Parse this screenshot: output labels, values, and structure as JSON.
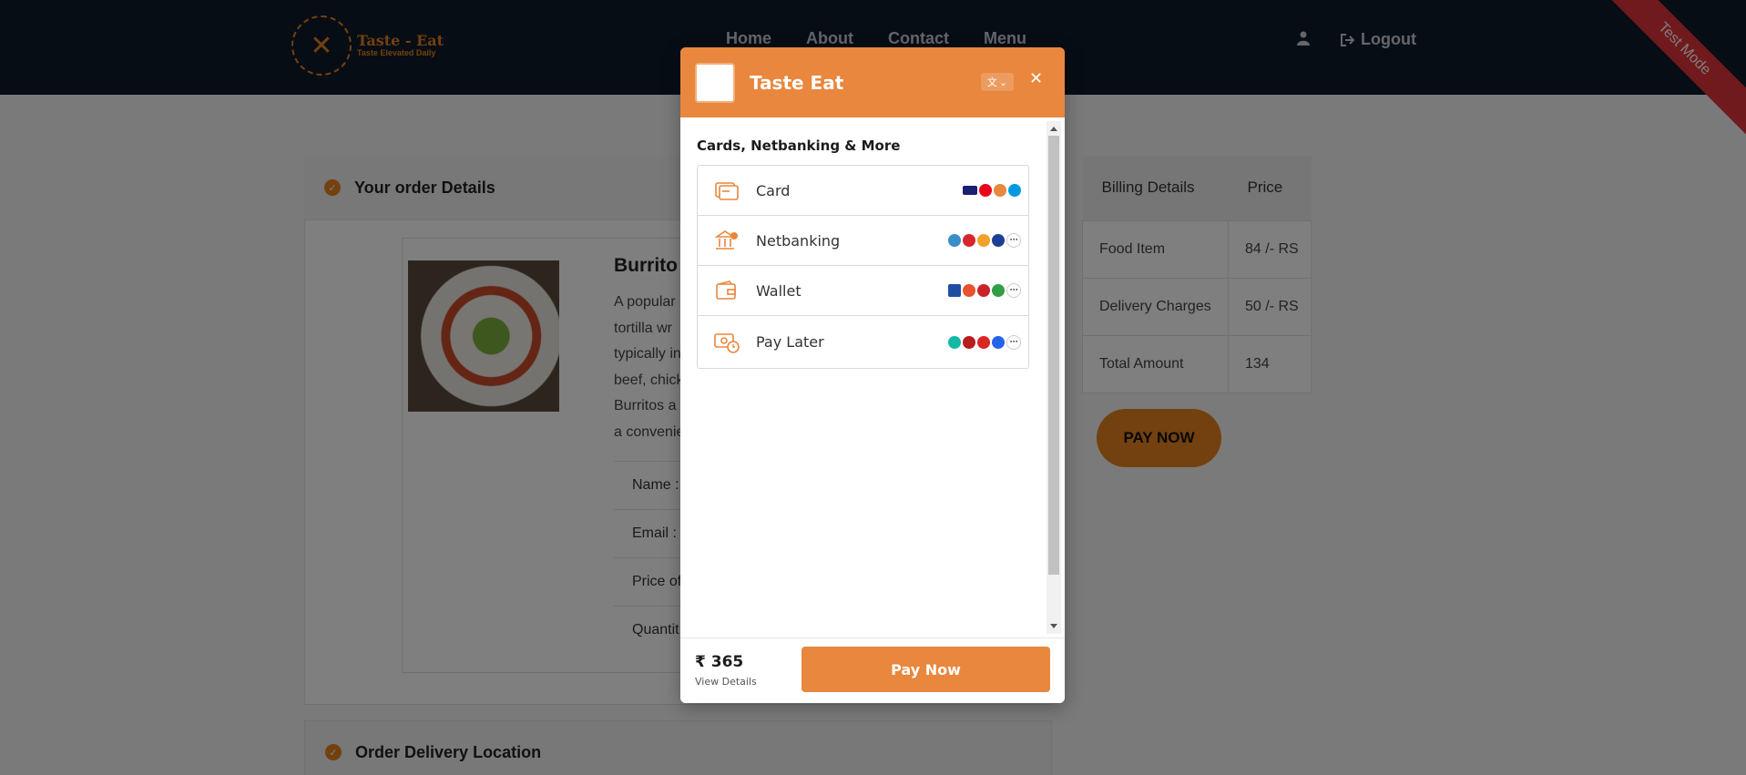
{
  "navbar": {
    "logo": {
      "name": "Taste - Eat",
      "tagline": "Taste Elevated Daily"
    },
    "links": [
      "Home",
      "About",
      "Contact",
      "Menu"
    ],
    "user_icon": "user-icon",
    "logout_icon": "logout-icon",
    "logout_label": "Logout"
  },
  "ribbon": "Test Mode",
  "order": {
    "title": "Your order Details",
    "item_name": "Burrito",
    "item_desc_lines": [
      "A popular",
      "tortilla wr",
      "typically in",
      "beef, chick",
      "Burritos a",
      "a convenie"
    ],
    "rows": [
      "Name :",
      "Email :",
      "Price of",
      "Quantit"
    ]
  },
  "delivery": {
    "title": "Order Delivery Location"
  },
  "billing": {
    "headers": [
      "Billing Details",
      "Price"
    ],
    "rows": [
      [
        "Food Item",
        "84 /- RS"
      ],
      [
        "Delivery Charges",
        "50 /- RS"
      ],
      [
        "Total Amount",
        "134"
      ]
    ],
    "pay_label": "PAY NOW"
  },
  "checkout": {
    "merchant": "Taste Eat",
    "section_title": "Cards, Netbanking & More",
    "methods": [
      {
        "label": "Card",
        "icon": "card-icon"
      },
      {
        "label": "Netbanking",
        "icon": "bank-icon"
      },
      {
        "label": "Wallet",
        "icon": "wallet-icon"
      },
      {
        "label": "Pay Later",
        "icon": "paylater-icon"
      }
    ],
    "amount": "₹ 365",
    "view_details": "View Details",
    "pay_button": "Pay Now",
    "colors": {
      "accent": "#e8873d",
      "nav_bg": "#0e1a2b",
      "ribbon": "#e2343a"
    }
  }
}
